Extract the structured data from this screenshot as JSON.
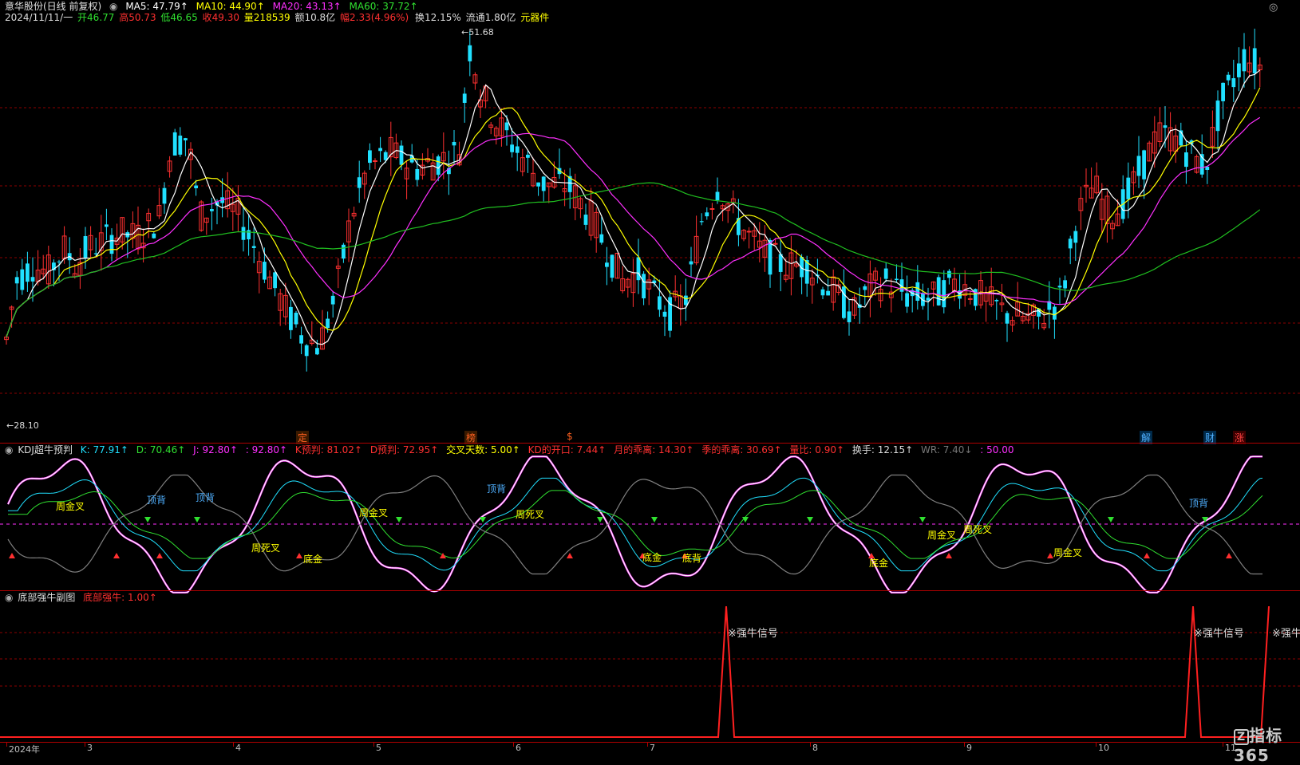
{
  "main": {
    "stock_title": "意华股份(日线 前复权)",
    "ma5": "MA5: 47.79↑",
    "ma10": "MA10: 44.90↑",
    "ma20": "MA20: 43.13↑",
    "ma60": "MA60: 37.72↑",
    "date": "2024/11/11/一",
    "open": "开46.77",
    "high": "高50.73",
    "low": "低46.65",
    "close": "收49.30",
    "volume": "量218539",
    "amount": "额10.8亿",
    "change": "幅2.33(4.96%)",
    "turnover": "换12.15%",
    "float": "流通1.80亿",
    "sector": "元器件",
    "max_label": "51.68",
    "min_label": "28.10",
    "event_tags": [
      {
        "text": "定",
        "color": "#ff6020"
      },
      {
        "text": "榜",
        "color": "#ff6020"
      },
      {
        "text": "$",
        "color": "#ff6020"
      },
      {
        "text": "解",
        "color": "#4fb0ff"
      },
      {
        "text": "财",
        "color": "#4fb0ff"
      },
      {
        "text": "涨",
        "color": "#ff4040"
      }
    ]
  },
  "kdj": {
    "title": "KDJ超牛预判",
    "k": "K: 77.91↑",
    "d": "D: 70.46↑",
    "j": "J: 92.80↑",
    "j2": ": 92.80↑",
    "k_pred": "K预判: 81.02↑",
    "d_pred": "D预判: 72.95↑",
    "cross_days": "交叉天数: 5.00↑",
    "kd_open": "KD的开口: 7.44↑",
    "month_dev": "月的乖离: 14.30↑",
    "season_dev": "季的乖离: 30.69↑",
    "vol_ratio": "量比: 0.90↑",
    "turnover": "换手: 12.15↑",
    "wr": "WR: 7.40↓",
    "wr2": ": 50.00",
    "labels": [
      {
        "text": "周金叉",
        "color": "#ffff00"
      },
      {
        "text": "顶背",
        "color": "#4fb0ff"
      },
      {
        "text": "顶背",
        "color": "#4fb0ff"
      },
      {
        "text": "周死叉",
        "color": "#ffff00"
      },
      {
        "text": "底金",
        "color": "#ffff00"
      },
      {
        "text": "周金叉",
        "color": "#ffff00"
      },
      {
        "text": "顶背",
        "color": "#4fb0ff"
      },
      {
        "text": "周死叉",
        "color": "#ffff00"
      },
      {
        "text": "底金",
        "color": "#ffff00"
      },
      {
        "text": "底背",
        "color": "#ffff00"
      },
      {
        "text": "底金",
        "color": "#ffff00"
      },
      {
        "text": "周金叉",
        "color": "#ffff00"
      },
      {
        "text": "周死叉",
        "color": "#ffff00"
      },
      {
        "text": "周金叉",
        "color": "#ffff00"
      },
      {
        "text": "顶背",
        "color": "#4fb0ff"
      }
    ]
  },
  "bull": {
    "title": "底部强牛副图",
    "value": "底部强牛: 1.00↑",
    "signals": [
      "※强牛信号",
      "※强牛信号",
      "※强牛"
    ]
  },
  "timeline": [
    "2024年",
    "3",
    "4",
    "5",
    "6",
    "7",
    "8",
    "9",
    "10",
    "11"
  ],
  "watermark": "指标365",
  "colors": {
    "up": "#ff3030",
    "down": "#20e0ff",
    "ma5": "#ffffff",
    "ma10": "#ffff00",
    "ma20": "#ff30ff",
    "ma60": "#20c020",
    "grid": "#8b0000"
  }
}
